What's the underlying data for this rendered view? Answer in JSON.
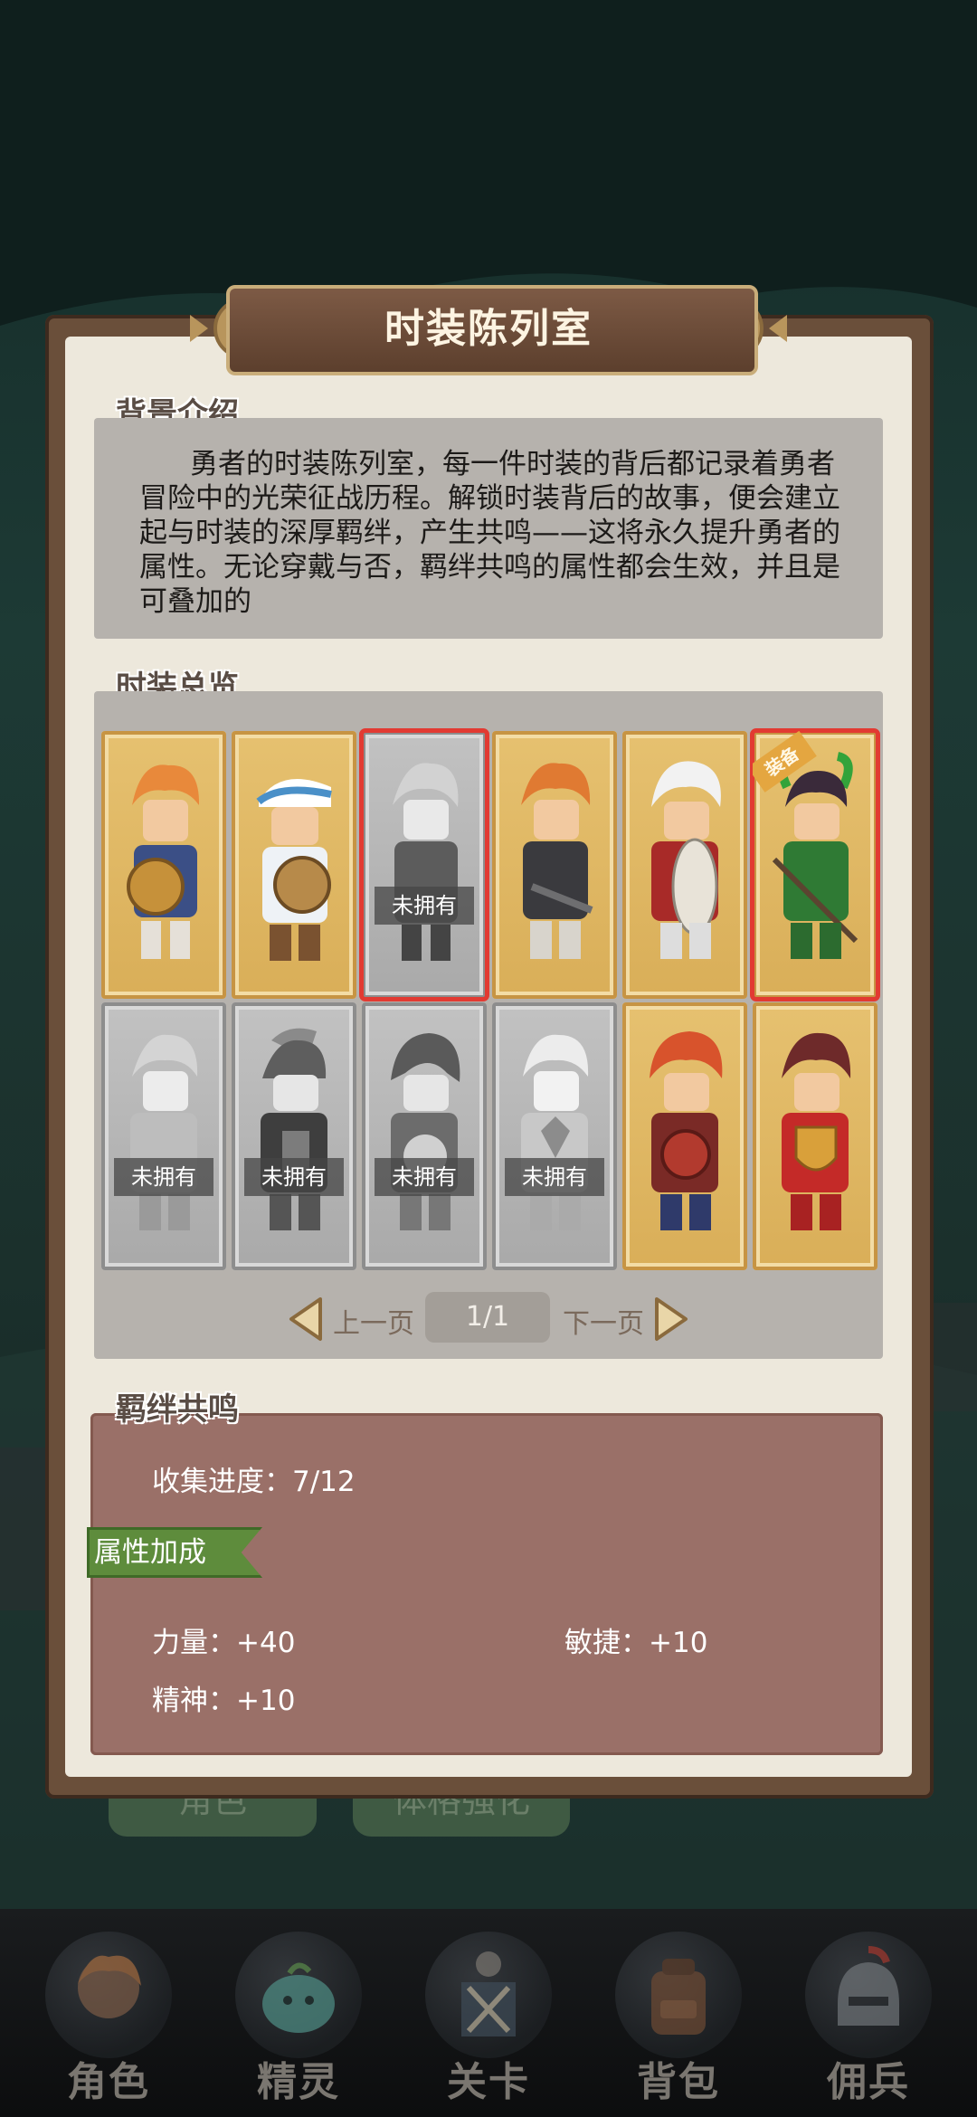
{
  "title": "时装陈列室",
  "background_section": {
    "heading": "背景介绍",
    "description": "勇者的时装陈列室，每一件时装的背后都记录着勇者冒险中的光荣征战历程。解锁时装背后的故事，便会建立起与时装的深厚羁绊，产生共鸣——这将永久提升勇者的属性。无论穿戴与否，羁绊共鸣的属性都会生效，并且是可叠加的"
  },
  "overview": {
    "heading": "时装总览",
    "unowned_label": "未拥有",
    "corner_tag": "装备",
    "costumes": [
      {
        "owned": true
      },
      {
        "owned": true
      },
      {
        "owned": false
      },
      {
        "owned": true
      },
      {
        "owned": true
      },
      {
        "owned": true
      },
      {
        "owned": false
      },
      {
        "owned": false
      },
      {
        "owned": false
      },
      {
        "owned": false
      },
      {
        "owned": true
      },
      {
        "owned": true
      }
    ]
  },
  "pager": {
    "prev": "上一页",
    "next": "下一页",
    "page": "1/1"
  },
  "bond": {
    "heading": "羁绊共鸣",
    "progress": "收集进度：7/12",
    "attr_heading": "属性加成",
    "stats": {
      "strength": "力量：+40",
      "agility": "敏捷：+10",
      "spirit": "精神：+10"
    }
  },
  "behind": {
    "tab_left": "角色",
    "tab_right": "体格强化"
  },
  "bottom_nav": [
    {
      "label": "角色",
      "icon": "hero-icon"
    },
    {
      "label": "精灵",
      "icon": "spirit-icon"
    },
    {
      "label": "关卡",
      "icon": "stage-icon"
    },
    {
      "label": "背包",
      "icon": "backpack-icon"
    },
    {
      "label": "佣兵",
      "icon": "mercenary-icon"
    }
  ],
  "colors": {
    "panel": "#ede8dc",
    "bond_box": "#9a7068",
    "selected_outline": "#e23a32",
    "ribbon": "#5e8c3c"
  }
}
